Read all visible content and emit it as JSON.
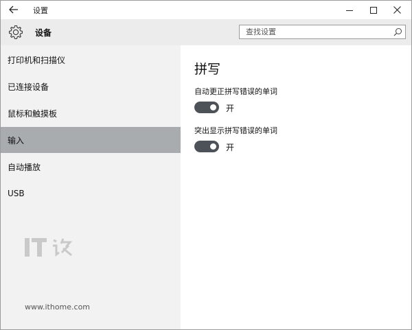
{
  "window": {
    "title": "设置",
    "back_icon": "back-arrow-icon",
    "minimize_icon": "minimize-icon",
    "maximize_icon": "maximize-icon",
    "close_icon": "close-icon"
  },
  "header": {
    "icon": "gear-icon",
    "title": "设备",
    "search": {
      "placeholder": "查找设置",
      "value": "",
      "icon": "search-icon"
    }
  },
  "sidebar": {
    "items": [
      {
        "label": "打印机和扫描仪",
        "selected": false
      },
      {
        "label": "已连接设备",
        "selected": false
      },
      {
        "label": "鼠标和触摸板",
        "selected": false
      },
      {
        "label": "输入",
        "selected": true
      },
      {
        "label": "自动播放",
        "selected": false
      },
      {
        "label": "USB",
        "selected": false
      }
    ],
    "watermark": {
      "logo_text": "IT之家",
      "url": "www.ithome.com"
    }
  },
  "main": {
    "section_title": "拼写",
    "settings": [
      {
        "label": "自动更正拼写错误的单词",
        "state": "开",
        "on": true
      },
      {
        "label": "突出显示拼写错误的单词",
        "state": "开",
        "on": true
      }
    ]
  },
  "colors": {
    "selected_item": "#a8acae",
    "toggle_on": "#4c5257",
    "sidebar_bg": "#f2f2f2",
    "header_bg": "#ececec"
  }
}
